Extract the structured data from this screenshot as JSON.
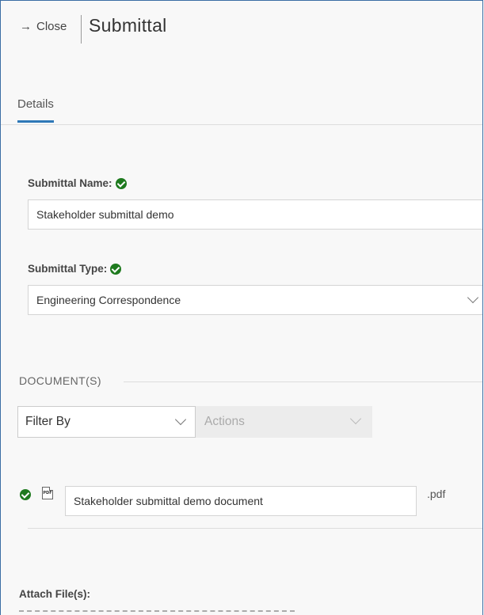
{
  "header": {
    "close_label": "Close",
    "close_icon": "arrow-right",
    "title": "Submittal"
  },
  "tabs": [
    {
      "label": "Details",
      "active": true
    }
  ],
  "form": {
    "name_label": "Submittal Name:",
    "name_value": "Stakeholder submittal demo",
    "type_label": "Submittal Type:",
    "type_value": "Engineering Correspondence"
  },
  "documents": {
    "section_title": "DOCUMENT(S)",
    "filter_label": "Filter By",
    "actions_label": "Actions",
    "items": [
      {
        "name": "Stakeholder submittal demo document",
        "extension": ".pdf",
        "file_icon": "pdf-file",
        "status_icon": "check-circle"
      }
    ]
  },
  "attach": {
    "label": "Attach File(s):"
  },
  "colors": {
    "accent": "#2e78b7",
    "check_green": "#1e7a1e",
    "panel_border": "#3b6ea5"
  }
}
